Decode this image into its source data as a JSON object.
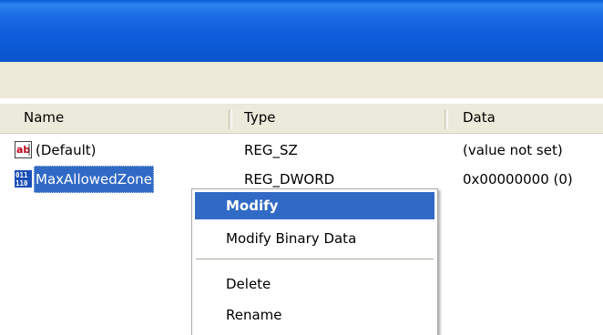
{
  "window": {
    "title": ""
  },
  "list": {
    "columns": [
      {
        "label": "Name"
      },
      {
        "label": "Type"
      },
      {
        "label": "Data"
      }
    ],
    "rows": [
      {
        "icon": "string-value-icon",
        "name": "(Default)",
        "type": "REG_SZ",
        "data": "(value not set)",
        "selected": false
      },
      {
        "icon": "dword-value-icon",
        "name": "MaxAllowedZone",
        "type": "REG_DWORD",
        "data": "0x00000000 (0)",
        "selected": true
      }
    ]
  },
  "context_menu": {
    "items": [
      {
        "label": "Modify",
        "default": true,
        "highlighted": true
      },
      {
        "label": "Modify Binary Data",
        "default": false,
        "highlighted": false
      },
      {
        "separator": true
      },
      {
        "label": "Delete",
        "default": false,
        "highlighted": false
      },
      {
        "label": "Rename",
        "default": false,
        "highlighted": false
      }
    ]
  },
  "colors": {
    "titlebar_blue": "#0f5fdd",
    "menubar_beige": "#ece9d8",
    "selection_blue": "#316ac5",
    "string_icon_red": "#c0001c",
    "dword_icon_blue": "#1b4fb8"
  }
}
